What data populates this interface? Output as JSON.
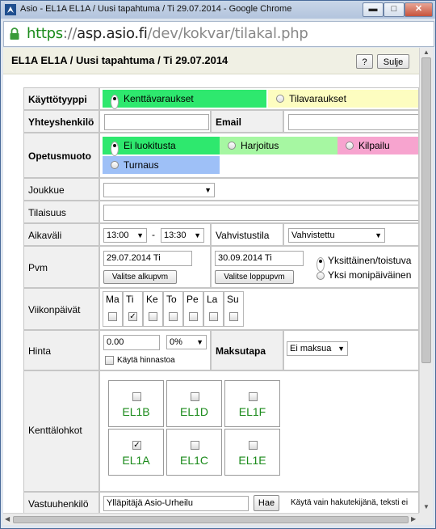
{
  "window": {
    "title": "Asio - EL1A EL1A / Uusi tapahtuma / Ti 29.07.2014 - Google Chrome",
    "buttons": {
      "minimize": "▬",
      "maximize": "□",
      "close": "✕"
    }
  },
  "urlbar": {
    "scheme": "https",
    "separator": "://",
    "host": "asp.asio.fi",
    "path": "/dev/kokvar/tilakal.php"
  },
  "header": {
    "title": "EL1A EL1A / Uusi tapahtuma / Ti 29.07.2014",
    "help_label": "?",
    "close_label": "Sulje"
  },
  "form": {
    "type": {
      "label": "Käyttötyyppi",
      "options": [
        {
          "label": "Kenttävaraukset",
          "selected": true,
          "color": "#2ee86e"
        },
        {
          "label": "Tilavaraukset",
          "selected": false,
          "color": "#fdfdc0"
        }
      ]
    },
    "contact": {
      "label": "Yhteyshenkilö",
      "value": "",
      "email_label": "Email",
      "email_value": ""
    },
    "teaching": {
      "label": "Opetusmuoto",
      "options": [
        {
          "label": "Ei luokitusta",
          "selected": true,
          "color": "#2ee86e"
        },
        {
          "label": "Harjoitus",
          "selected": false,
          "color": "#a6f7a2"
        },
        {
          "label": "Kilpailu",
          "selected": false,
          "color": "#f7a4cf"
        },
        {
          "label": "Turnaus",
          "selected": false,
          "color": "#9ec0f7"
        }
      ]
    },
    "team": {
      "label": "Joukkue",
      "value": ""
    },
    "occasion": {
      "label": "Tilaisuus",
      "value": ""
    },
    "time": {
      "label": "Aikaväli",
      "start": "13:00",
      "dash": "-",
      "end": "13:30",
      "confirm_label": "Vahvistustila",
      "confirm_value": "Vahvistettu"
    },
    "date": {
      "label": "Pvm",
      "start": "29.07.2014 Ti",
      "end": "30.09.2014 Ti",
      "pick_start": "Valitse alkupvm",
      "pick_end": "Valitse loppupvm",
      "modes": [
        {
          "label": "Yksittäinen/toistuva",
          "selected": true
        },
        {
          "label": "Yksi monipäiväinen",
          "selected": false
        }
      ]
    },
    "weekdays": {
      "label": "Viikonpäivät",
      "days": [
        {
          "name": "Ma",
          "checked": false
        },
        {
          "name": "Ti",
          "checked": true
        },
        {
          "name": "Ke",
          "checked": false
        },
        {
          "name": "To",
          "checked": false
        },
        {
          "name": "Pe",
          "checked": false
        },
        {
          "name": "La",
          "checked": false
        },
        {
          "name": "Su",
          "checked": false
        }
      ]
    },
    "price": {
      "label": "Hinta",
      "value": "0.00",
      "vat": "0%",
      "use_pricelist": "Käytä hinnastoa",
      "payment_label": "Maksutapa",
      "payment_value": "Ei maksua"
    },
    "fields": {
      "label": "Kenttälohkot",
      "blocks": [
        {
          "name": "EL1B",
          "checked": false
        },
        {
          "name": "EL1D",
          "checked": false
        },
        {
          "name": "EL1F",
          "checked": false
        },
        {
          "name": "EL1A",
          "checked": true
        },
        {
          "name": "EL1C",
          "checked": false
        },
        {
          "name": "EL1E",
          "checked": false
        }
      ]
    },
    "responsible": {
      "label": "Vastuuhenkilö",
      "value": "Ylläpitäjä Asio-Urheilu",
      "search_label": "Hae",
      "hint": "Käytä vain hakutekijänä, teksti ei"
    }
  }
}
